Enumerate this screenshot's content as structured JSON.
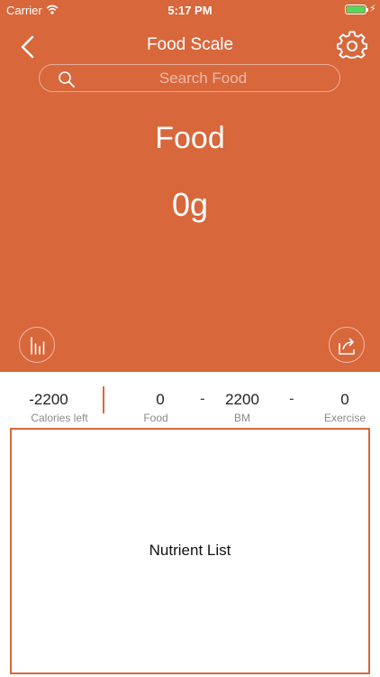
{
  "status_bar": {
    "carrier": "Carrier",
    "time": "5:17 PM"
  },
  "nav": {
    "title": "Food Scale",
    "back_icon": "chevron-left-icon",
    "settings_icon": "gear-icon"
  },
  "search": {
    "placeholder": "Search Food",
    "value": ""
  },
  "food": {
    "name": "Food",
    "weight": "0g"
  },
  "actions": {
    "chart_icon": "bar-chart-icon",
    "share_icon": "share-icon"
  },
  "stats": {
    "calories_left": {
      "value": "-2200",
      "label": "Calories left"
    },
    "food": {
      "value": "0",
      "label": "Food"
    },
    "minus1": "-",
    "bm": {
      "value": "2200",
      "label": "BM"
    },
    "minus2": "-",
    "exercise": {
      "value": "0",
      "label": "Exercise"
    }
  },
  "nutrients": {
    "title": "Nutrient List"
  },
  "colors": {
    "accent": "#d8673c",
    "battery": "#4cd964"
  }
}
